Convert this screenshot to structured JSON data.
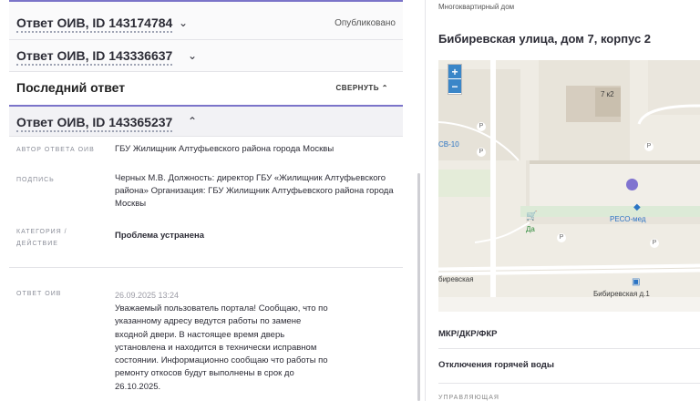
{
  "left": {
    "responses": [
      {
        "title": "Ответ ОИВ, ID 143174784",
        "status": "Опубликовано"
      },
      {
        "title": "Ответ ОИВ, ID 143336637"
      }
    ],
    "last_answer": {
      "header": "Последний ответ",
      "collapse_label": "СВЕРНУТЬ",
      "title": "Ответ ОИВ, ID 143365237",
      "fields": [
        {
          "label": "АВТОР ОТВЕТА ОИВ",
          "value": "ГБУ Жилищник Алтуфьевского района города Москвы"
        },
        {
          "label": "ПОДПИСЬ",
          "value": "Черных М.В. Должность: директор ГБУ «Жилищник Алтуфьевского района» Организация: ГБУ Жилищник Алтуфьевского района города Москвы"
        },
        {
          "label": "КАТЕГОРИЯ / ДЕЙСТВИЕ",
          "value": "Проблема устранена"
        }
      ],
      "answer": {
        "label": "ОТВЕТ ОИВ",
        "date": "26.09.2025 13:24",
        "text": "Уважаемый пользователь портала! Сообщаю, что по указанному адресу ведутся работы по замене входной двери. В настоящее время дверь установлена и находится в технически исправном состоянии. Информационно сообщаю что работы по ремонту откосов будут выполнены в срок до 26.10.2025."
      }
    }
  },
  "right": {
    "house_type": "Многоквартирный дом",
    "address": "Бибиревская улица, дом 7, корпус 2",
    "map": {
      "zoom_in": "+",
      "zoom_out": "−",
      "labels": {
        "building": "7 к2",
        "bus": "СВ-10",
        "resomed": "РЕСО-мед",
        "shop": "Да",
        "street": "биревская",
        "stop": "Бибиревская д.1"
      }
    },
    "sections": [
      "МКР/ДКР/ФКР",
      "Отключения горячей воды"
    ],
    "bottom_cut": "УПРАВЛЯЮЩАЯ"
  }
}
